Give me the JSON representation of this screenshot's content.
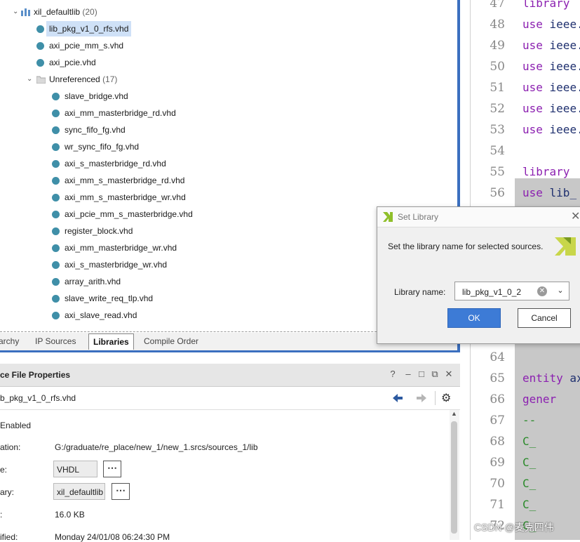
{
  "tree": {
    "root": {
      "label": "xil_defaultlib",
      "count": "(20)"
    },
    "items": [
      {
        "label": "lib_pkg_v1_0_rfs.vhd",
        "selected": true
      },
      {
        "label": "axi_pcie_mm_s.vhd"
      },
      {
        "label": "axi_pcie.vhd"
      }
    ],
    "unref": {
      "label": "Unreferenced",
      "count": "(17)"
    },
    "unref_items": [
      "slave_bridge.vhd",
      "axi_mm_masterbridge_rd.vhd",
      "sync_fifo_fg.vhd",
      "wr_sync_fifo_fg.vhd",
      "axi_s_masterbridge_rd.vhd",
      "axi_mm_s_masterbridge_rd.vhd",
      "axi_mm_s_masterbridge_wr.vhd",
      "axi_pcie_mm_s_masterbridge.vhd",
      "register_block.vhd",
      "axi_mm_masterbridge_wr.vhd",
      "axi_s_masterbridge_wr.vhd",
      "array_arith.vhd",
      "slave_write_req_tlp.vhd",
      "axi_slave_read.vhd"
    ]
  },
  "tabs": [
    "archy",
    "IP Sources",
    "Libraries",
    "Compile Order"
  ],
  "properties": {
    "title": "ce File Properties",
    "file_name": "b_pkg_v1_0_rfs.vhd",
    "enabled_label": "Enabled",
    "location_label": "ation:",
    "location_value": "G:/graduate/re_place/new_1/new_1.srcs/sources_1/lib",
    "type_label": "e:",
    "type_value": "VHDL",
    "library_label": "ary:",
    "library_value": "xil_defaultlib",
    "size_label": ":",
    "size_value": "16.0 KB",
    "modified_label": "ified:",
    "modified_value": "Monday 24/01/08 06:24:30 PM",
    "more_button": "⋯",
    "header_icons": [
      "?",
      "–",
      "□",
      "⧉",
      "✕"
    ]
  },
  "editor": {
    "lines": [
      {
        "num": "47",
        "kw": "library",
        "rest": ""
      },
      {
        "num": "48",
        "kw": "use",
        "rest": " ieee."
      },
      {
        "num": "49",
        "kw": "use",
        "rest": " ieee."
      },
      {
        "num": "50",
        "kw": "use",
        "rest": " ieee."
      },
      {
        "num": "51",
        "kw": "use",
        "rest": " ieee."
      },
      {
        "num": "52",
        "kw": "use",
        "rest": " ieee."
      },
      {
        "num": "53",
        "kw": "use",
        "rest": " ieee."
      },
      {
        "num": "54",
        "kw": "",
        "rest": ""
      },
      {
        "num": "55",
        "kw": "library",
        "rest": " "
      },
      {
        "num": "56",
        "kw": "use",
        "rest": " lib_"
      }
    ],
    "lines_lower": [
      {
        "num": "64",
        "kw": "",
        "rest": ""
      },
      {
        "num": "65",
        "kw": "entity",
        "rest": " ax"
      },
      {
        "num": "66",
        "kw": "  gener",
        "rest": ""
      },
      {
        "num": "67",
        "kw": "",
        "rest": "     --"
      },
      {
        "num": "68",
        "kw": "",
        "rest": "    C_"
      },
      {
        "num": "69",
        "kw": "",
        "rest": "    C_"
      },
      {
        "num": "70",
        "kw": "",
        "rest": "    C_"
      },
      {
        "num": "71",
        "kw": "",
        "rest": "    C_"
      },
      {
        "num": "72",
        "kw": "",
        "rest": "    C_"
      }
    ]
  },
  "dialog": {
    "title": "Set Library",
    "message": "Set the library name for selected sources.",
    "field_label": "Library name:",
    "field_value": "lib_pkg_v1_0_2",
    "ok": "OK",
    "cancel": "Cancel"
  },
  "watermark": "CSDN @麦克四伟"
}
